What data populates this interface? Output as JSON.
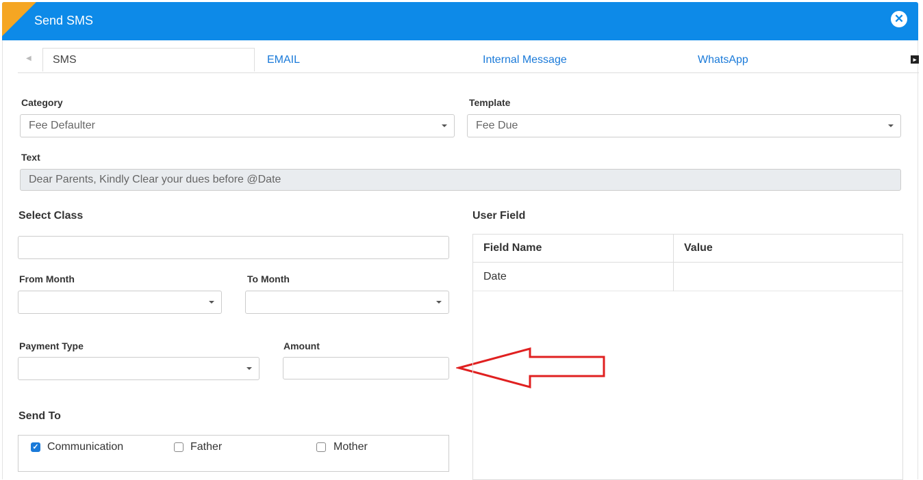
{
  "header": {
    "title": "Send SMS"
  },
  "tabs": [
    {
      "label": "SMS"
    },
    {
      "label": "EMAIL"
    },
    {
      "label": "Internal Message"
    },
    {
      "label": "WhatsApp"
    }
  ],
  "form": {
    "category": {
      "label": "Category",
      "value": "Fee Defaulter"
    },
    "template": {
      "label": "Template",
      "value": "Fee Due"
    },
    "text": {
      "label": "Text",
      "value": "Dear Parents, Kindly Clear your dues before @Date"
    },
    "select_class": {
      "label": "Select Class",
      "value": ""
    },
    "from_month": {
      "label": "From Month",
      "value": ""
    },
    "to_month": {
      "label": "To Month",
      "value": ""
    },
    "payment_type": {
      "label": "Payment Type",
      "value": ""
    },
    "amount": {
      "label": "Amount",
      "value": ""
    },
    "send_to": {
      "label": "Send To",
      "options": [
        {
          "label": "Communication",
          "checked": true
        },
        {
          "label": "Father",
          "checked": false
        },
        {
          "label": "Mother",
          "checked": false
        }
      ]
    }
  },
  "user_field": {
    "label": "User Field",
    "columns": [
      "Field Name",
      "Value"
    ],
    "rows": [
      {
        "field": "Date",
        "value": ""
      }
    ]
  },
  "colors": {
    "header": "#0d8ae8",
    "accent": "#f5a623",
    "link": "#1a7ad9",
    "annotation_arrow": "#e02020"
  }
}
